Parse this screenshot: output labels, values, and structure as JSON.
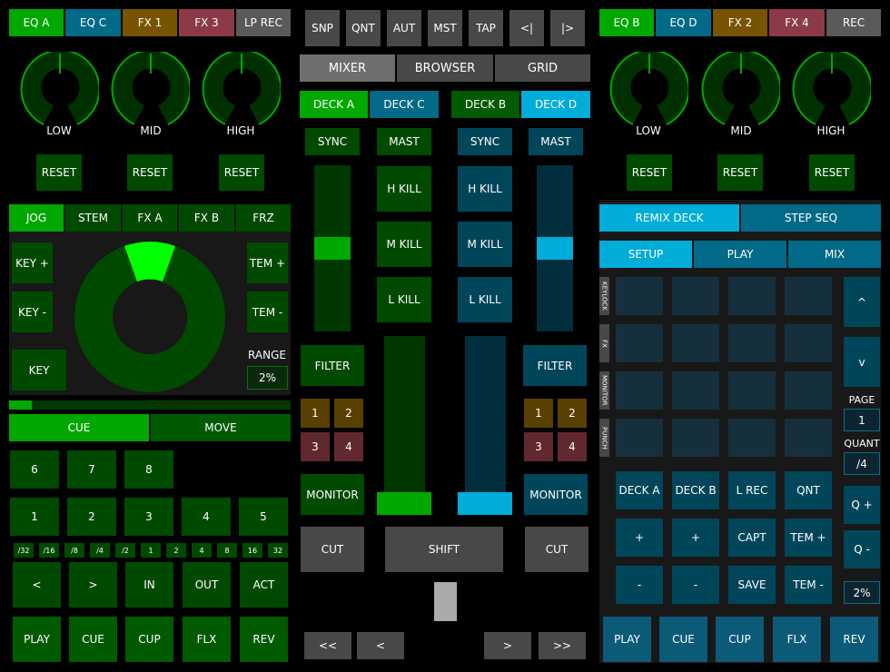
{
  "left": {
    "top_tabs": [
      {
        "label": "EQ A",
        "color": "#00a800"
      },
      {
        "label": "EQ C",
        "color": "#006a88"
      },
      {
        "label": "FX 1",
        "color": "#775400"
      },
      {
        "label": "FX 3",
        "color": "#8c3a48"
      },
      {
        "label": "LP REC",
        "color": "#5a5a5a"
      }
    ],
    "knobs": [
      {
        "label": "LOW",
        "value": 0.5
      },
      {
        "label": "MID",
        "value": 0.5
      },
      {
        "label": "HIGH",
        "value": 0.5
      }
    ],
    "reset_label": "RESET",
    "mode_tabs": [
      "JOG",
      "STEM",
      "FX A",
      "FX B",
      "FRZ"
    ],
    "active_mode": "JOG",
    "key_plus": "KEY +",
    "key_minus": "KEY -",
    "key": "KEY",
    "tem_plus": "TEM +",
    "tem_minus": "TEM -",
    "range_label": "RANGE",
    "range_value": "2%",
    "progress": 0.08,
    "cue": "CUE",
    "move": "MOVE",
    "hotcues_row1": [
      "6",
      "7",
      "8"
    ],
    "hotcues_row2": [
      "1",
      "2",
      "3",
      "4",
      "5"
    ],
    "loop_sizes": [
      "/32",
      "/16",
      "/8",
      "/4",
      "/2",
      "1",
      "2",
      "4",
      "8",
      "16",
      "32"
    ],
    "loop_controls": [
      "<",
      ">",
      "IN",
      "OUT",
      "ACT"
    ],
    "transport": [
      "PLAY",
      "CUE",
      "CUP",
      "FLX",
      "REV"
    ]
  },
  "center": {
    "top_buttons": [
      "SNP",
      "QNT",
      "AUT",
      "MST",
      "TAP",
      "<|",
      "|>"
    ],
    "view_tabs": [
      "MIXER",
      "BROWSER",
      "GRID"
    ],
    "active_view": "MIXER",
    "deck_tabs_left": [
      "DECK A",
      "DECK C"
    ],
    "deck_tabs_right": [
      "DECK B",
      "DECK D"
    ],
    "sync": "SYNC",
    "mast": "MAST",
    "h_kill": "H KILL",
    "m_kill": "M KILL",
    "l_kill": "L KILL",
    "filter": "FILTER",
    "fx_units": [
      "1",
      "2",
      "3",
      "4"
    ],
    "monitor": "MONITOR",
    "cut": "CUT",
    "shift": "SHIFT",
    "tempo_left": 0.5,
    "tempo_right": 0.5,
    "volume_left": 1.0,
    "volume_right": 1.0,
    "crossfader": 0.5,
    "nav": [
      "<<",
      "<",
      ">",
      ">>"
    ]
  },
  "right": {
    "top_tabs": [
      {
        "label": "EQ B",
        "color": "#00a800"
      },
      {
        "label": "EQ D",
        "color": "#006a88"
      },
      {
        "label": "FX 2",
        "color": "#775400"
      },
      {
        "label": "FX 4",
        "color": "#8c3a48"
      },
      {
        "label": "REC",
        "color": "#5a5a5a"
      }
    ],
    "knobs": [
      {
        "label": "LOW",
        "value": 0.5
      },
      {
        "label": "MID",
        "value": 0.5
      },
      {
        "label": "HIGH",
        "value": 0.5
      }
    ],
    "reset_label": "RESET",
    "main_tabs": [
      "REMIX DECK",
      "STEP SEQ"
    ],
    "sub_tabs": [
      "SETUP",
      "PLAY",
      "MIX"
    ],
    "side_labels": [
      "KEYLOCK",
      "FX",
      "MONITOR",
      "PUNCH"
    ],
    "up": "^",
    "down": "v",
    "page_label": "PAGE",
    "page_value": "1",
    "quant_label": "QUANT",
    "quant_value": "/4",
    "q_plus": "Q +",
    "q_minus": "Q -",
    "range_value": "2%",
    "grid_row1": [
      "DECK A",
      "DECK B",
      "L REC",
      "QNT"
    ],
    "grid_row2": [
      "+",
      "+",
      "CAPT",
      "TEM +"
    ],
    "grid_row3": [
      "-",
      "-",
      "SAVE",
      "TEM -"
    ],
    "transport": [
      "PLAY",
      "CUE",
      "CUP",
      "FLX",
      "REV"
    ]
  }
}
